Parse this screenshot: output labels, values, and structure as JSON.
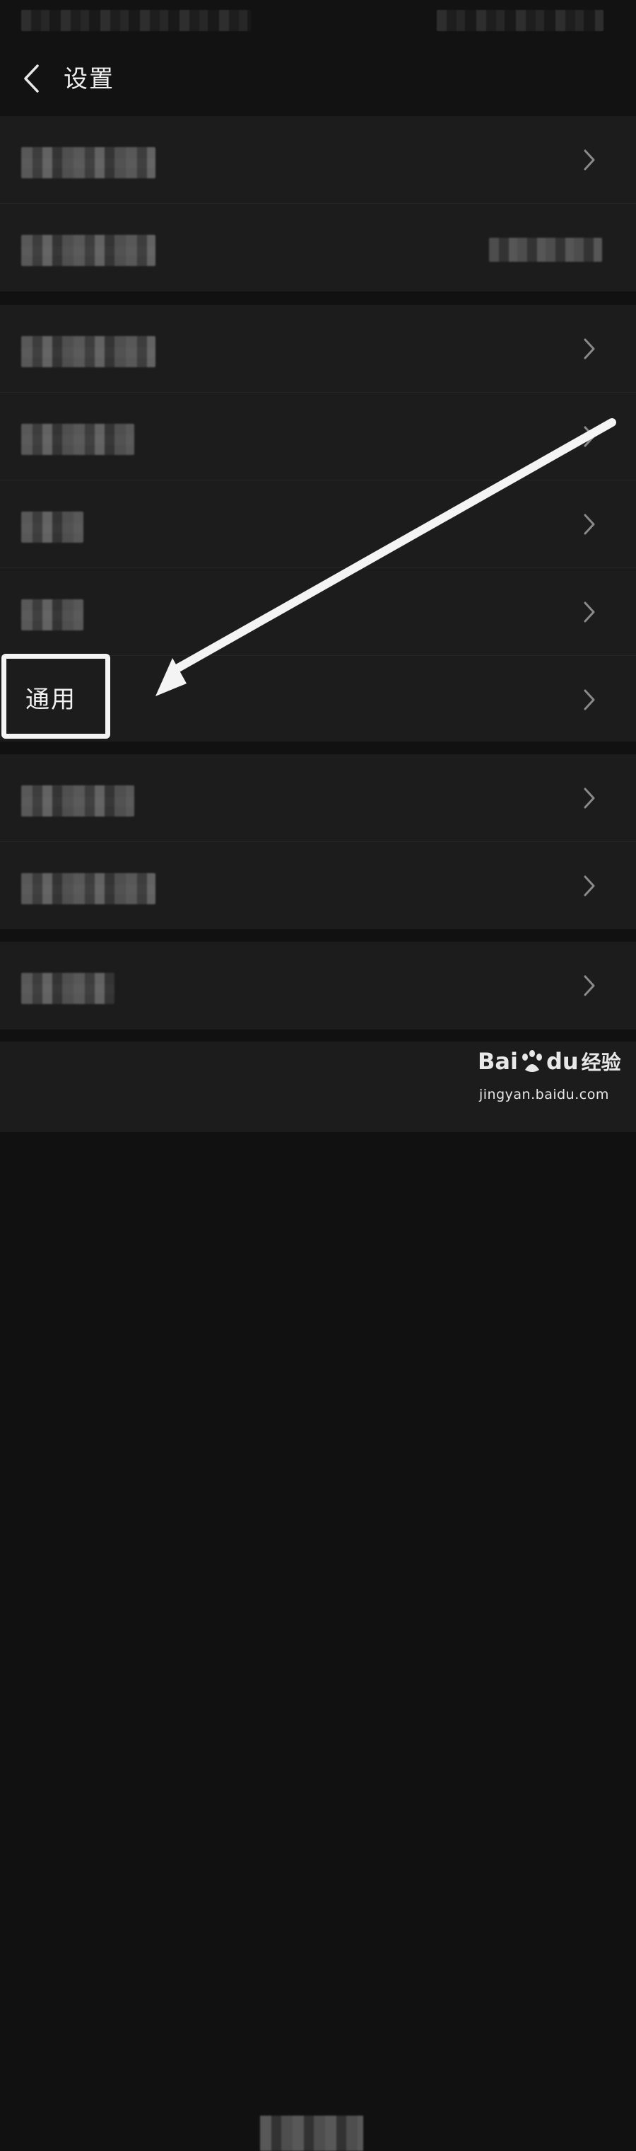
{
  "header": {
    "title": "设置",
    "back_icon": "chevron-left-icon"
  },
  "highlighted_item": {
    "label": "通用"
  },
  "icons": {
    "row_chevron": "chevron-right-icon",
    "annotation": "arrow-icon"
  },
  "watermark": {
    "brand_latin": "Bai",
    "brand_latin_suffix": "du",
    "brand_cn": "经验",
    "url": "jingyan.baidu.com"
  },
  "colors": {
    "background": "#111111",
    "row_background": "#1c1c1c",
    "text": "#f2f2f2",
    "chevron": "#8a8a8a",
    "annotation": "#f4f4f4"
  }
}
